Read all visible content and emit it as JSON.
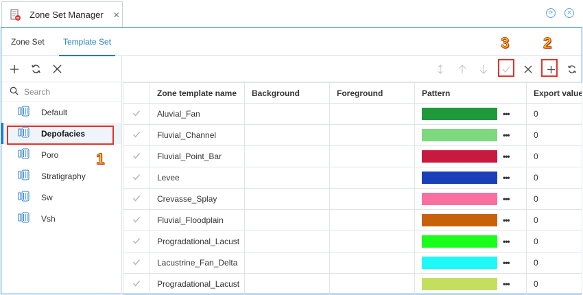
{
  "window": {
    "title": "Zone Set Manager"
  },
  "icons": {
    "app": "zone-set-manager-icon",
    "close": "close-icon",
    "add": "plus-icon",
    "refresh": "refresh-icon",
    "remove": "x-icon",
    "search": "search-icon",
    "zone": "zone-set-icon",
    "sort": "sort-icon",
    "up": "arrow-up-icon",
    "down": "arrow-down-icon",
    "apply": "checkmark-icon"
  },
  "tabs": [
    {
      "label": "Zone Set",
      "active": false
    },
    {
      "label": "Template Set",
      "active": true
    }
  ],
  "search": {
    "placeholder": "Search"
  },
  "template_sets": [
    {
      "label": "Default",
      "selected": false
    },
    {
      "label": "Depofacies",
      "selected": true
    },
    {
      "label": "Poro",
      "selected": false
    },
    {
      "label": "Stratigraphy",
      "selected": false
    },
    {
      "label": "Sw",
      "selected": false
    },
    {
      "label": "Vsh",
      "selected": false
    }
  ],
  "table": {
    "headers": [
      "",
      "Zone template name",
      "Background",
      "Foreground",
      "Pattern",
      "Export value"
    ],
    "rows": [
      {
        "name": "Aluvial_Fan",
        "background": "",
        "foreground": "",
        "color": "#1e9a3a",
        "export": "0"
      },
      {
        "name": "Fluvial_Channel",
        "background": "",
        "foreground": "",
        "color": "#7ed87e",
        "export": "0"
      },
      {
        "name": "Fluvial_Point_Bar",
        "background": "",
        "foreground": "",
        "color": "#c81a3e",
        "export": "0"
      },
      {
        "name": "Levee",
        "background": "",
        "foreground": "",
        "color": "#1a3fb8",
        "export": "0"
      },
      {
        "name": "Crevasse_Splay",
        "background": "",
        "foreground": "",
        "color": "#f96fa0",
        "export": "0"
      },
      {
        "name": "Fluvial_Floodplain",
        "background": "",
        "foreground": "",
        "color": "#c8620a",
        "export": "0"
      },
      {
        "name": "Progradational_Lacust",
        "background": "",
        "foreground": "",
        "color": "#1aff1a",
        "export": "0"
      },
      {
        "name": "Lacustrine_Fan_Delta",
        "background": "",
        "foreground": "",
        "color": "#1ef9f7",
        "export": "0"
      },
      {
        "name": "Progradational_Lacust",
        "background": "",
        "foreground": "",
        "color": "#c4df60",
        "export": "0"
      }
    ],
    "more_label": "•••"
  },
  "callouts": [
    "1",
    "2",
    "3"
  ],
  "colors": {
    "accent": "#1f7dc9",
    "callout_box": "#e4322b",
    "callout_text": "#f4d411"
  }
}
